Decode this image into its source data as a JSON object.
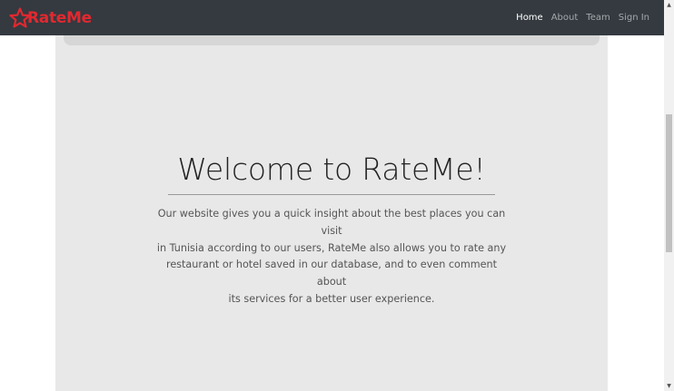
{
  "brand": {
    "name": "RateMe",
    "logo_icon": "star-icon",
    "color": "#e2282f"
  },
  "nav": {
    "items": [
      {
        "label": "Home",
        "active": true
      },
      {
        "label": "About",
        "active": false
      },
      {
        "label": "Team",
        "active": false
      },
      {
        "label": "Sign In",
        "active": false
      }
    ]
  },
  "hero": {
    "title": "Welcome to RateMe!",
    "lines": [
      "Our website gives you a quick insight about the best places you can visit",
      "in Tunisia according to our users, RateMe also allows you to rate any",
      "restaurant or hotel saved in our database, and to even comment about",
      "its services for a better user experience."
    ]
  },
  "scrollbar": {
    "up_icon": "scroll-up-arrow-icon",
    "down_icon": "scroll-down-arrow-icon"
  }
}
